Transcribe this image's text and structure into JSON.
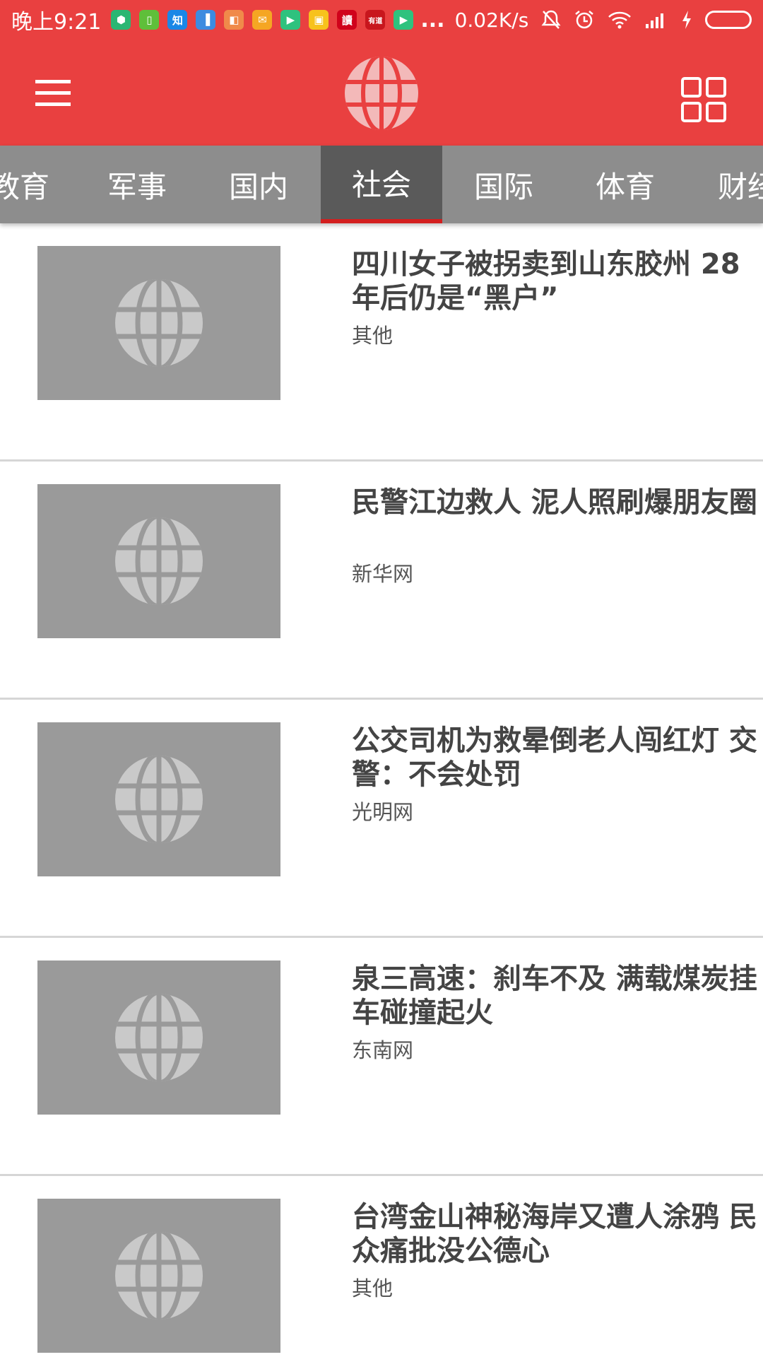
{
  "status_bar": {
    "time": "晚上9:21",
    "notifications": [
      {
        "icon": "security-app-icon",
        "glyph": "⬢",
        "color": "#2bb673"
      },
      {
        "icon": "phone-manager-icon",
        "glyph": "▯",
        "color": "#5fbf3a"
      },
      {
        "icon": "zhihu-icon",
        "glyph": "知",
        "color": "#1a87e6"
      },
      {
        "icon": "books-app-icon",
        "glyph": "▐",
        "color": "#3d8be0"
      },
      {
        "icon": "shopping-app-icon",
        "glyph": "◧",
        "color": "#f08a4a"
      },
      {
        "icon": "mail-icon",
        "glyph": "✉",
        "color": "#f5a623"
      },
      {
        "icon": "video-app-icon",
        "glyph": "▶",
        "color": "#2ec27e"
      },
      {
        "icon": "box-app-icon",
        "glyph": "▣",
        "color": "#f7c21c"
      },
      {
        "icon": "reader-app-icon",
        "glyph": "讀",
        "color": "#d0021b"
      },
      {
        "icon": "youdao-icon",
        "glyph": "有道",
        "color": "#c8161d"
      },
      {
        "icon": "player-app-icon",
        "glyph": "▶",
        "color": "#2ec27e"
      }
    ],
    "more": "...",
    "network_speed": "0.02K/s"
  },
  "toolbar": {
    "menu_icon": "hamburger-menu-icon",
    "logo_icon": "globe-logo-icon",
    "grid_icon": "grid-view-icon"
  },
  "tabs": [
    {
      "label": "教育",
      "active": false
    },
    {
      "label": "军事",
      "active": false
    },
    {
      "label": "国内",
      "active": false
    },
    {
      "label": "社会",
      "active": true
    },
    {
      "label": "国际",
      "active": false
    },
    {
      "label": "体育",
      "active": false
    },
    {
      "label": "财经",
      "active": false
    }
  ],
  "news": [
    {
      "title": "四川女子被拐卖到山东胶州 28年后仍是“黑户”",
      "source": "其他"
    },
    {
      "title": "民警江边救人 泥人照刷爆朋友圈",
      "source": "新华网"
    },
    {
      "title": "公交司机为救晕倒老人闯红灯 交警：不会处罚",
      "source": "光明网"
    },
    {
      "title": "泉三高速：刹车不及 满载煤炭挂车碰撞起火",
      "source": "东南网"
    },
    {
      "title": "台湾金山神秘海岸又遭人涂鸦 民众痛批没公德心",
      "source": "其他"
    }
  ],
  "colors": {
    "brand_red": "#e94040",
    "tab_bg": "#8d8d8d",
    "tab_active_bg": "#5a5a5a",
    "tab_indicator": "#d31f1f",
    "thumb_placeholder": "#9a9a9a"
  }
}
